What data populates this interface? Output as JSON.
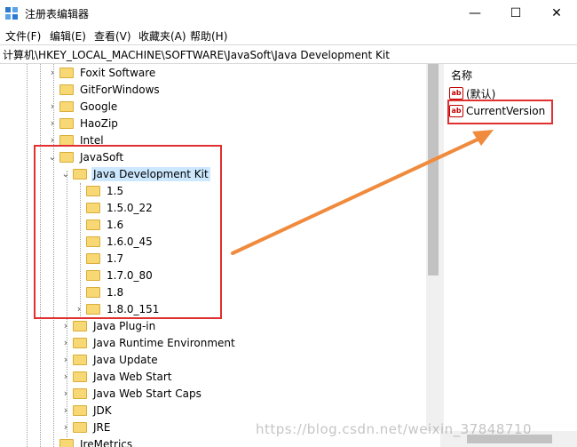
{
  "window": {
    "title": "注册表编辑器",
    "min": "—",
    "max": "☐",
    "close": "✕"
  },
  "menu": [
    {
      "label": "文件(F)"
    },
    {
      "label": "编辑(E)"
    },
    {
      "label": "查看(V)"
    },
    {
      "label": "收藏夹(A)"
    },
    {
      "label": "帮助(H)"
    }
  ],
  "address": "计算机\\HKEY_LOCAL_MACHINE\\SOFTWARE\\JavaSoft\\Java Development Kit",
  "tree": [
    {
      "label": "Foxit Software",
      "expander": "›"
    },
    {
      "label": "GitForWindows",
      "expander": ""
    },
    {
      "label": "Google",
      "expander": "›"
    },
    {
      "label": "HaoZip",
      "expander": "›"
    },
    {
      "label": "Intel",
      "expander": "›"
    },
    {
      "label": "JavaSoft",
      "expander": "⌄"
    },
    {
      "label": "Java Development Kit",
      "expander": "⌄"
    },
    {
      "label": "1.5",
      "expander": ""
    },
    {
      "label": "1.5.0_22",
      "expander": ""
    },
    {
      "label": "1.6",
      "expander": ""
    },
    {
      "label": "1.6.0_45",
      "expander": ""
    },
    {
      "label": "1.7",
      "expander": ""
    },
    {
      "label": "1.7.0_80",
      "expander": ""
    },
    {
      "label": "1.8",
      "expander": ""
    },
    {
      "label": "1.8.0_151",
      "expander": "›"
    },
    {
      "label": "Java Plug-in",
      "expander": "›"
    },
    {
      "label": "Java Runtime Environment",
      "expander": "›"
    },
    {
      "label": "Java Update",
      "expander": "›"
    },
    {
      "label": "Java Web Start",
      "expander": "›"
    },
    {
      "label": "Java Web Start Caps",
      "expander": "›"
    },
    {
      "label": "JDK",
      "expander": "›"
    },
    {
      "label": "JRE",
      "expander": "›"
    },
    {
      "label": "JreMetrics",
      "expander": ""
    }
  ],
  "values": {
    "header": "名称",
    "icon_text": "ab",
    "rows": [
      {
        "name": "(默认)"
      },
      {
        "name": "CurrentVersion"
      }
    ]
  },
  "watermark": "https://blog.csdn.net/weixin_37848710",
  "colors": {
    "highlight": "#e0302f",
    "arrow": "#f08a3c",
    "selection": "#cce8ff"
  }
}
